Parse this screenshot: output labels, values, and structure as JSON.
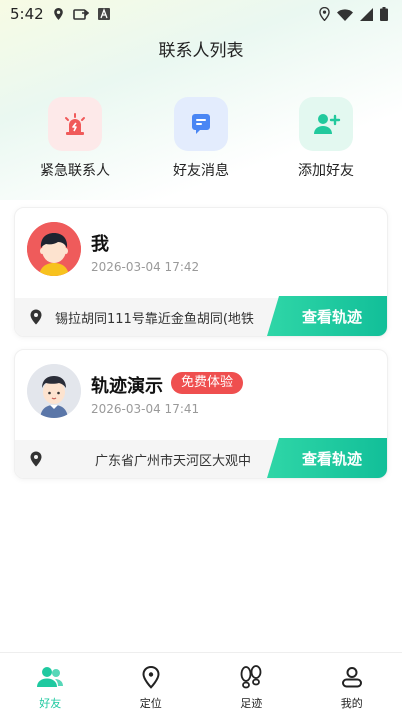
{
  "status_bar": {
    "time": "5:42",
    "left_icons": [
      "location-icon",
      "forward-icon",
      "a-icon"
    ],
    "right_icons": [
      "location-icon",
      "wifi-icon",
      "signal-icon",
      "battery-icon"
    ]
  },
  "header": {
    "title": "联系人列表"
  },
  "quick_actions": [
    {
      "label": "紧急联系人",
      "icon": "alarm-icon",
      "bg": "#fde9e9",
      "color": "#f05a5a"
    },
    {
      "label": "好友消息",
      "icon": "message-icon",
      "bg": "#e3ecfd",
      "color": "#4a86f4"
    },
    {
      "label": "添加好友",
      "icon": "add-user-icon",
      "bg": "#e3f8f0",
      "color": "#22c99d"
    }
  ],
  "contacts": [
    {
      "name": "我",
      "time": "2026-03-04 17:42",
      "address": "锡拉胡同111号靠近金鱼胡同(地铁",
      "action": "查看轨迹",
      "badge": ""
    },
    {
      "name": "轨迹演示",
      "time": "2026-03-04 17:41",
      "address": "广东省广州市天河区大观中",
      "action": "查看轨迹",
      "badge": "免费体验"
    }
  ],
  "tabbar": {
    "active": 0,
    "accent": "#1fc9a0",
    "items": [
      {
        "label": "好友",
        "icon": "friends-icon"
      },
      {
        "label": "定位",
        "icon": "location-pin-icon"
      },
      {
        "label": "足迹",
        "icon": "footprints-icon"
      },
      {
        "label": "我的",
        "icon": "profile-icon"
      }
    ]
  }
}
